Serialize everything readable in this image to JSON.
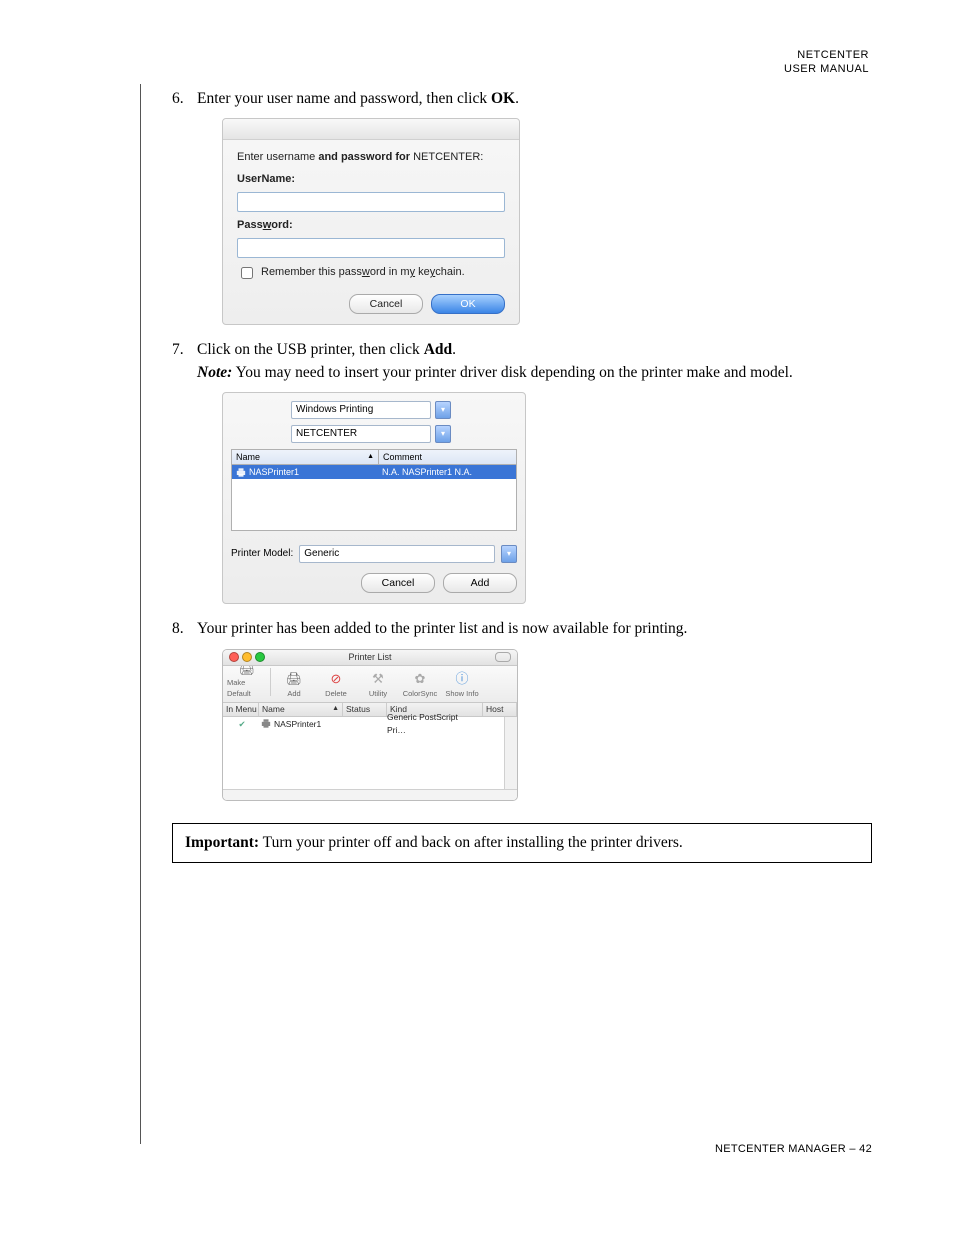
{
  "header": {
    "line1": "NETCENTER",
    "line2": "USER MANUAL"
  },
  "steps": {
    "s6": {
      "num": "6.",
      "text_a": "Enter your user name and password, then click ",
      "text_bold": "OK",
      "text_c": "."
    },
    "s7": {
      "num": "7.",
      "line1_a": "Click on the USB printer, then click ",
      "line1_bold": "Add",
      "line1_c": ".",
      "note_label": "Note:",
      "note_text": " You may need to insert your printer driver disk depending on the printer make and model."
    },
    "s8": {
      "num": "8.",
      "text": "Your printer has been added to the printer list and is now available for printing."
    }
  },
  "auth": {
    "prompt_a": "Enter username ",
    "prompt_b": "and password for",
    "prompt_c": " NETCENTER:",
    "username_label": "UserName:",
    "password_label_a": "Pass",
    "password_label_b": "w",
    "password_label_c": "ord:",
    "remember_a": "Remember this pass",
    "remember_b": "w",
    "remember_c": "ord in m",
    "remember_d": "y",
    "remember_e": " ke",
    "remember_f": "y",
    "remember_g": "chain.",
    "cancel": "Cancel",
    "ok": "OK"
  },
  "addprinter": {
    "combo1": "Windows Printing",
    "combo2": "NETCENTER",
    "col_name": "Name",
    "col_comment": "Comment",
    "row_name": "NASPrinter1",
    "row_comment": "N.A. NASPrinter1 N.A.",
    "model_label": "Printer Model:",
    "model_value": "Generic",
    "cancel": "Cancel",
    "add": "Add"
  },
  "plist": {
    "title": "Printer List",
    "tb": {
      "make_default": "Make Default",
      "add": "Add",
      "delete": "Delete",
      "utility": "Utility",
      "colorsync": "ColorSync",
      "showinfo": "Show Info"
    },
    "cols": {
      "in_menu": "In Menu",
      "name": "Name",
      "status": "Status",
      "kind": "Kind",
      "host": "Host"
    },
    "row": {
      "name": "NASPrinter1",
      "kind": "Generic PostScript Pri…"
    }
  },
  "important": {
    "label": "Important:",
    "text": " Turn your printer off and back on after installing the printer drivers."
  },
  "footer": "NETCENTER MANAGER – 42"
}
